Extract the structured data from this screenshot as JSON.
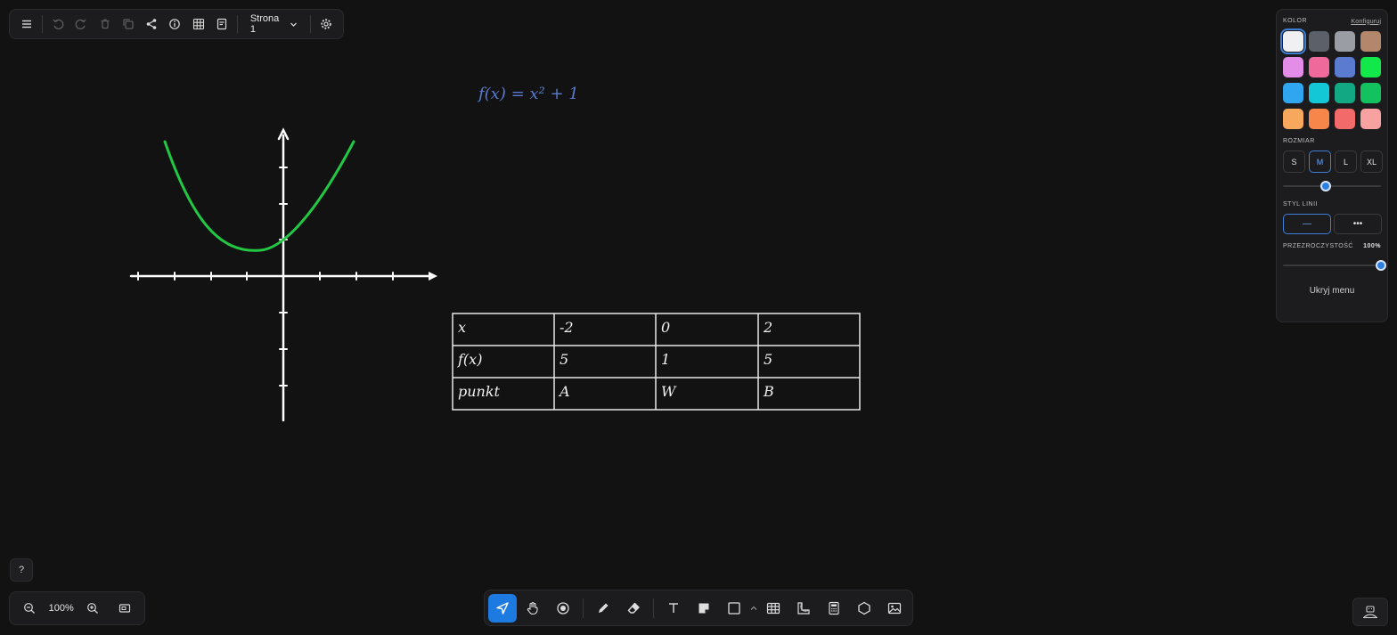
{
  "top_toolbar": {
    "page_label": "Strona 1",
    "icons": [
      "menu-icon",
      "undo-icon",
      "redo-icon",
      "trash-icon",
      "duplicate-icon",
      "share-icon",
      "info-icon",
      "grid-icon",
      "notes-icon",
      "settings-icon"
    ]
  },
  "canvas": {
    "formula": "f(x) = x² + 1",
    "curve_color": "#22c743",
    "formula_color": "#5b7bd1",
    "table": {
      "rows": [
        [
          "x",
          "-2",
          "0",
          "2"
        ],
        [
          "f(x)",
          "5",
          "1",
          "5"
        ],
        [
          "punkt",
          "A",
          "W",
          "B"
        ]
      ]
    }
  },
  "style_panel": {
    "color_label": "KOLOR",
    "configure_link": "Konfiguruj",
    "colors": [
      "#f0f0f2",
      "#5c6068",
      "#9a9da3",
      "#b3876c",
      "#e38ce8",
      "#f0699b",
      "#5b7bd1",
      "#12e84a",
      "#30a6f0",
      "#13c7d6",
      "#12a883",
      "#13c25f",
      "#f7a85c",
      "#f7864a",
      "#f26a6a",
      "#f7a1a1"
    ],
    "selected_color_index": 0,
    "size_label": "ROZMIAR",
    "sizes": [
      "S",
      "M",
      "L",
      "XL"
    ],
    "selected_size": "M",
    "size_slider_value": 0.44,
    "line_style_label": "STYL LINII",
    "line_styles": [
      "—",
      "•••"
    ],
    "opacity_label": "PRZEZROCZYSTOŚĆ",
    "opacity_value": "100%",
    "opacity_slider_value": 1.0,
    "hide_menu_label": "Ukryj menu"
  },
  "help": {
    "label": "?"
  },
  "zoom": {
    "value": "100%"
  },
  "tools": {
    "items": [
      "select-tool",
      "hand-tool",
      "laser-tool",
      "pen-tool",
      "eraser-tool",
      "text-tool",
      "sticky-note-tool",
      "shape-tool",
      "table-tool",
      "ruler-tool",
      "calculator-tool",
      "polygon-tool",
      "image-tool"
    ],
    "active": "select-tool"
  }
}
